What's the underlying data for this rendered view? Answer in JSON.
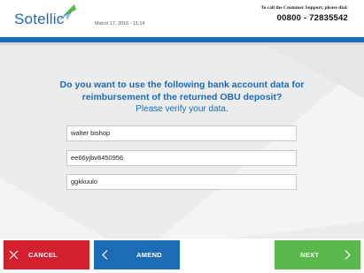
{
  "header": {
    "brand": "Sotellic",
    "datetime": "March 17, 2016 - 11:14",
    "support_label": "To call the Customer Support, please dial:",
    "support_phone": "00800 - 72835542"
  },
  "main": {
    "question_line1": "Do you want to use the following bank account data for",
    "question_line2": "reimbursement of the returned OBU deposit?",
    "verify_text": "Please verify your data.",
    "fields": [
      {
        "value": "walter bishop"
      },
      {
        "value": "ee66yjbv8450956"
      },
      {
        "value": "ggkkuulo"
      }
    ]
  },
  "footer": {
    "cancel_label": "CANCEL",
    "amend_label": "AMEND",
    "next_label": "NEXT"
  },
  "colors": {
    "brand_blue": "#1b6cb5",
    "cancel_red": "#d2202f",
    "next_green": "#5ab94c",
    "background_grey": "#ececec"
  },
  "icons": {
    "logo": "sotellic-logo-icon",
    "cancel": "close-icon",
    "amend": "chevron-left-icon",
    "next": "chevron-right-icon"
  }
}
